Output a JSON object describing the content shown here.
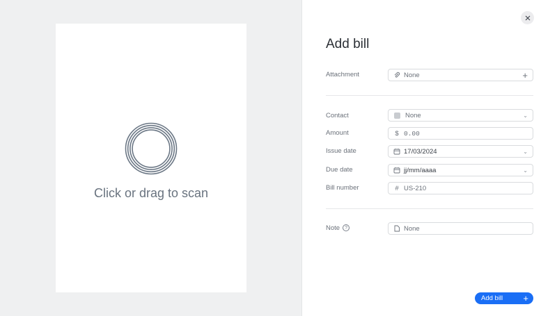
{
  "scanner": {
    "prompt": "Click or drag to scan"
  },
  "panel": {
    "title": "Add bill"
  },
  "fields": {
    "attachment": {
      "label": "Attachment",
      "value": "None"
    },
    "contact": {
      "label": "Contact",
      "value": "None"
    },
    "amount": {
      "label": "Amount",
      "currency_symbol": "$",
      "placeholder": "0.00"
    },
    "issue_date": {
      "label": "Issue date",
      "value": "17/03/2024"
    },
    "due_date": {
      "label": "Due date",
      "placeholder": "jj/mm/aaaa"
    },
    "bill_number": {
      "label": "Bill number",
      "symbol": "#",
      "value": "US-210"
    },
    "note": {
      "label": "Note",
      "help": "?",
      "value": "None"
    }
  },
  "actions": {
    "submit_label": "Add bill"
  },
  "colors": {
    "accent": "#1a6ef5",
    "left_bg": "#eff0f1"
  }
}
